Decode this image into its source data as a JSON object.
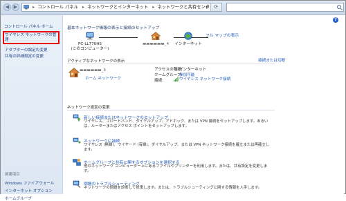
{
  "address_bar": {
    "crumbs": [
      "コントロール パネル",
      "ネットワークとインターネット",
      "ネットワークと共有センター"
    ]
  },
  "left_pane": {
    "home": "コントロール パネル ホーム",
    "links": [
      "ワイヤレス ネットワークの管理",
      "アダプターの設定の変更",
      "共有の詳細設定の変更"
    ],
    "see_also_label": "関連項目",
    "see_also_links": [
      "Windows ファイアウォール",
      "インターネット オプション",
      "ホームグループ"
    ]
  },
  "main": {
    "basic_header": "基本ネットワーク情報の表示と接続のセットアップ",
    "full_map": "フル マップの表示",
    "map_nodes": {
      "computer_name": "PC-LL770HS",
      "computer_sub": "(このコンピューター)",
      "middle_name": "▬▬▬▬▬▬_4",
      "internet": "インターネット"
    },
    "active_header": "アクティブなネットワークの表示",
    "connect_disconnect": "接続または切断",
    "network_name": "▬▬▬▬▬▬_4",
    "network_type": "ホーム ネットワーク",
    "access_type_label": "アクセスの種類:",
    "access_type_value": "インターネット",
    "homegroup_label": "ホームグループ:",
    "homegroup_value": "参加可能",
    "connection_label": "接続:",
    "connection_value": "ワイヤレス ネットワーク接続",
    "change_header": "ネットワーク設定の変更",
    "tasks": [
      {
        "title": "新しい接続またはネットワークのセットアップ",
        "desc": "ワイヤレス、ブロードバンド、ダイヤルアップ、アドホック、または VPN 接続をセットアップします。あるいは、ルーターまたはアクセス ポイントをセットアップします。"
      },
      {
        "title": "ネットワークに接続",
        "desc": "ワイヤレス (無線)、ワイヤード (有線)、ダイヤルアップ、または VPN ネットワーク接続を確立または再確立します。"
      },
      {
        "title": "ホームグループと共有に関するオプションを選択する",
        "desc": "他のネットワーク コンピューター上にあるファイルやプリンターを利用します。または、共有設定を変更します。"
      },
      {
        "title": "問題のトラブルシューティング",
        "desc": "ネットワークの問題を診断して修復します。または、トラブルシューティングに関する情報を入手します。"
      }
    ]
  }
}
